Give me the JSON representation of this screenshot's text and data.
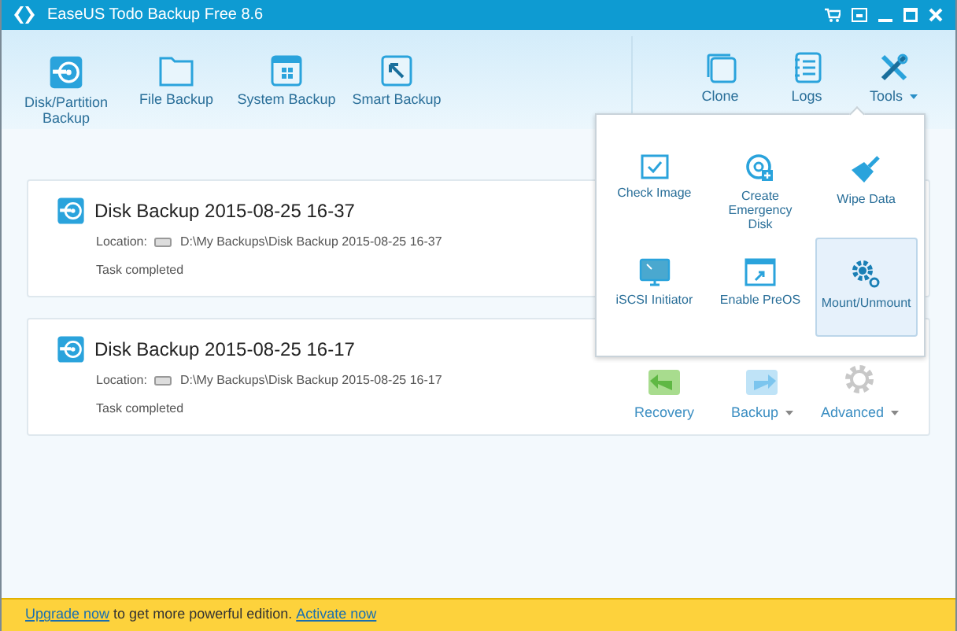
{
  "window": {
    "title": "EaseUS Todo Backup Free 8.6"
  },
  "toolbar": {
    "left_items": [
      {
        "label": "Disk/Partition\nBackup"
      },
      {
        "label": "File Backup"
      },
      {
        "label": "System Backup"
      },
      {
        "label": "Smart Backup"
      }
    ],
    "right_items": [
      {
        "label": "Clone",
        "dropdown": false
      },
      {
        "label": "Logs",
        "dropdown": false
      },
      {
        "label": "Tools",
        "dropdown": true
      }
    ]
  },
  "tools_menu": {
    "expanded": true,
    "items": [
      {
        "label": "Check Image",
        "selected": false
      },
      {
        "label": "Create Emergency\nDisk",
        "selected": false
      },
      {
        "label": "Wipe Data",
        "selected": false
      },
      {
        "label": "iSCSI Initiator",
        "selected": false
      },
      {
        "label": "Enable PreOS",
        "selected": false
      },
      {
        "label": "Mount/Unmount",
        "selected": true
      }
    ]
  },
  "backups": [
    {
      "title": "Disk Backup 2015-08-25 16-37",
      "location_label": "Location:",
      "location": "D:\\My Backups\\Disk Backup 2015-08-25 16-37",
      "status": "Task completed"
    },
    {
      "title": "Disk Backup 2015-08-25 16-17",
      "location_label": "Location:",
      "location": "D:\\My Backups\\Disk Backup 2015-08-25 16-17",
      "status": "Task completed",
      "actions": [
        {
          "label": "Recovery",
          "kind": "recovery",
          "dropdown": false
        },
        {
          "label": "Backup",
          "kind": "backup",
          "dropdown": true
        },
        {
          "label": "Advanced",
          "kind": "advanced",
          "dropdown": true
        }
      ]
    }
  ],
  "footer": [
    {
      "text": "Upgrade now",
      "kind": "link"
    },
    {
      "text": " to get more powerful edition. ",
      "kind": "text"
    },
    {
      "text": "Activate now",
      "kind": "link"
    }
  ]
}
